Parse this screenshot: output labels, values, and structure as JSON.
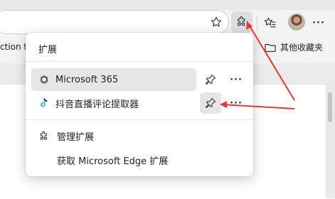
{
  "toolbar": {
    "star_icon": "star-icon",
    "extensions_icon": "puzzle-icon",
    "favorites_icon": "favorites-icon",
    "more_label": "···"
  },
  "bookmarks": {
    "left_fragment": "ction to",
    "folder_label": "其他收藏夹"
  },
  "popup": {
    "title": "扩展",
    "extensions": [
      {
        "name": "Microsoft 365",
        "icon": "microsoft365-icon",
        "highlighted": true
      },
      {
        "name": "抖音直播评论提取器",
        "icon": "tiktok-icon",
        "highlighted": false
      }
    ],
    "more_label": "···",
    "manage_label": "管理扩展",
    "get_label": "获取 Microsoft Edge 扩展"
  },
  "annotation": {
    "color": "#e53935"
  }
}
